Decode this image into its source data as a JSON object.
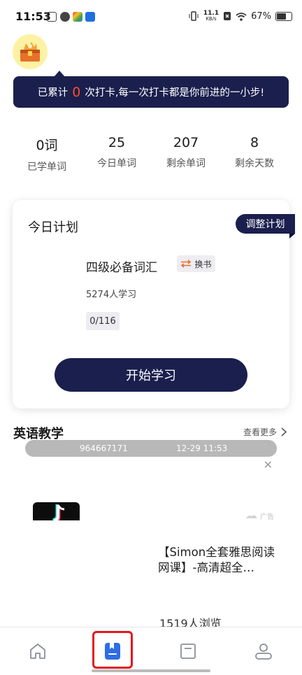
{
  "status_bar": {
    "time": "11:53",
    "speed_value": "11.1",
    "speed_unit": "KB/s",
    "battery": "67%"
  },
  "banner": {
    "prefix": "已累计",
    "count": "0",
    "suffix": "次打卡,每一次打卡都是你前进的一小步!"
  },
  "stats": [
    {
      "value": "0词",
      "label": "已学单词"
    },
    {
      "value": "25",
      "label": "今日单词"
    },
    {
      "value": "207",
      "label": "剩余单词"
    },
    {
      "value": "8",
      "label": "剩余天数"
    }
  ],
  "plan": {
    "title": "今日计划",
    "adjust_label": "调整计划",
    "book_name": "四级必备词汇",
    "swap_label": "换书",
    "learners": "5274人学习",
    "progress": "0/116",
    "start_label": "开始学习"
  },
  "section": {
    "title": "英语教学",
    "see_more": "查看更多"
  },
  "notice": {
    "id": "964667171",
    "time": "12-29 11:53"
  },
  "ad": {
    "label": "广告",
    "title": "【Simon全套雅思阅读网课】-高清超全…",
    "views": "1519人浏览"
  },
  "nav": {
    "items": [
      "home-icon",
      "wordbook-icon",
      "book-icon",
      "profile-icon"
    ],
    "active_index": 1
  },
  "colors": {
    "navy": "#1a1f4d",
    "accent_red": "#ff4b2b",
    "active_blue": "#2e6de6",
    "highlight_red": "#e3191c"
  }
}
